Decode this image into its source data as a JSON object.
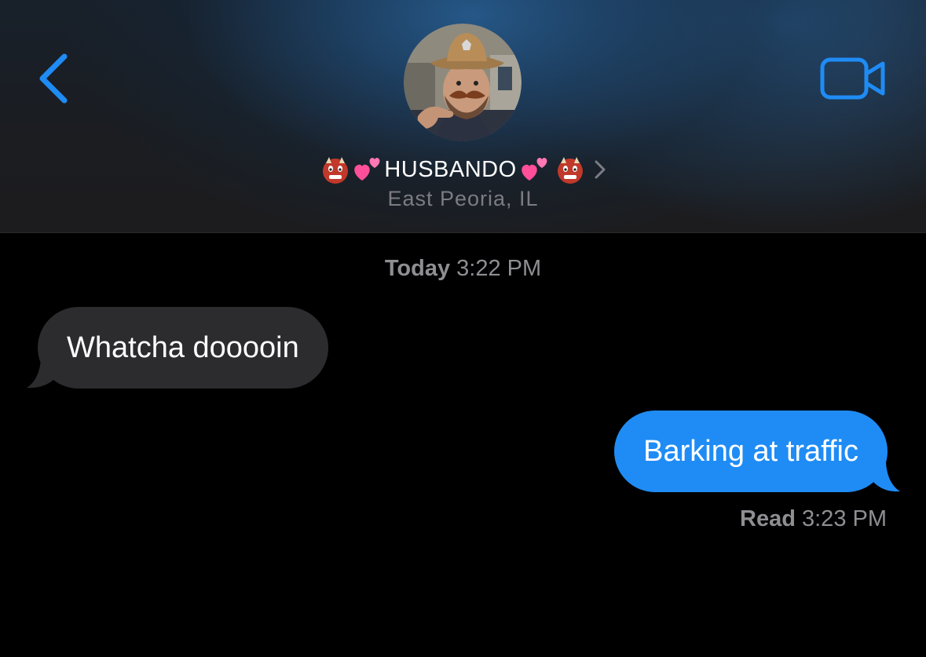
{
  "colors": {
    "accent": "#1f8cf5",
    "incoming_bubble": "#2c2c2e",
    "background": "#000000",
    "secondary_text": "#8e8e93"
  },
  "header": {
    "back_icon": "chevron-left-icon",
    "video_icon": "video-camera-icon",
    "avatar_icon": "contact-avatar-photo",
    "contact": {
      "name": "HUSBANDO",
      "name_emojis": [
        "ogre-face-emoji",
        "two-hearts-emoji",
        "two-hearts-emoji",
        "ogre-face-emoji"
      ],
      "subtitle": "East Peoria, IL"
    }
  },
  "conversation": {
    "timestamp": {
      "label": "Today",
      "time": "3:22 PM"
    },
    "messages": [
      {
        "direction": "incoming",
        "text": "Whatcha dooooin"
      },
      {
        "direction": "outgoing",
        "text": "Barking at traffic"
      }
    ],
    "read_receipt": {
      "label": "Read",
      "time": "3:23 PM"
    }
  }
}
